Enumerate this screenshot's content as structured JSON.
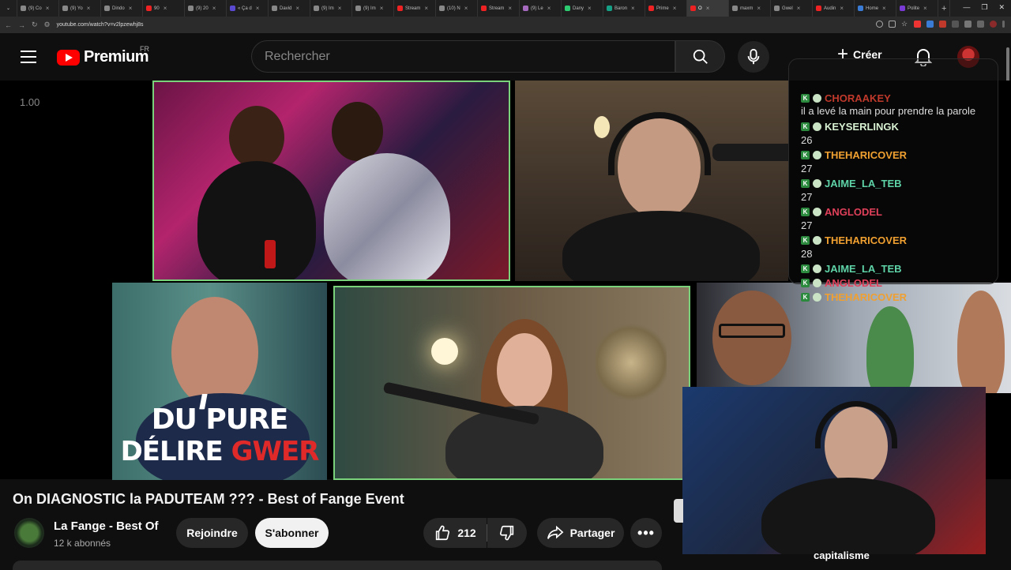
{
  "browser": {
    "tabs": [
      {
        "label": "(9) Co",
        "color": "#888"
      },
      {
        "label": "(9) Yo",
        "color": "#888"
      },
      {
        "label": "Dindo",
        "color": "#888"
      },
      {
        "label": "90",
        "color": "#e22"
      },
      {
        "label": "(9) 20",
        "color": "#888"
      },
      {
        "label": "« Ça d",
        "color": "#5a4ad1"
      },
      {
        "label": "David",
        "color": "#888"
      },
      {
        "label": "(9) Im",
        "color": "#888"
      },
      {
        "label": "(9) Im",
        "color": "#888"
      },
      {
        "label": "Stream",
        "color": "#e22"
      },
      {
        "label": "(10) N",
        "color": "#888"
      },
      {
        "label": "Stream",
        "color": "#e22"
      },
      {
        "label": "(9) Le",
        "color": "#a569bd"
      },
      {
        "label": "Dany",
        "color": "#2ecc71"
      },
      {
        "label": "Baron",
        "color": "#16a085"
      },
      {
        "label": "Prime",
        "color": "#e22"
      },
      {
        "label": "O",
        "color": "#e22",
        "active": true
      },
      {
        "label": "maxm",
        "color": "#888"
      },
      {
        "label": "Gwel",
        "color": "#888"
      },
      {
        "label": "Audin",
        "color": "#e22"
      },
      {
        "label": "Home",
        "color": "#3a7bd5"
      },
      {
        "label": "Polite",
        "color": "#7a3ad5"
      }
    ],
    "url": "youtube.com/watch?v=v2lpzewhj8s"
  },
  "header": {
    "logo_text": "Premium",
    "country": "FR",
    "search_placeholder": "Rechercher",
    "create_label": "Créer"
  },
  "video": {
    "speed": "1.00",
    "overlay_line1": "DU PURE",
    "overlay_line2a": "DÉLIRE ",
    "overlay_line2b": "GWER",
    "overlay_slashes": "////"
  },
  "chat": {
    "first_user": "CHORAAKEY",
    "first_user_color": "#c0392b",
    "first_msg": "il a levé la main pour prendre la parole",
    "entries": [
      {
        "user": "KEYSERLINGK",
        "color": "#d8f0d2",
        "num": "26"
      },
      {
        "user": "THEHARICOVER",
        "color": "#f0a030",
        "num": "27"
      },
      {
        "user": "JAIME_LA_TEB",
        "color": "#5fd3a8",
        "num": "27"
      },
      {
        "user": "ANGLODEL",
        "color": "#e0405a",
        "num": "27"
      },
      {
        "user": "THEHARICOVER",
        "color": "#f0a030",
        "num": "28"
      },
      {
        "user": "JAIME_LA_TEB",
        "color": "#5fd3a8",
        "num": ""
      },
      {
        "user": "ANGLODEL",
        "color": "#e0405a",
        "num": ""
      },
      {
        "user": "THEHARICOVER",
        "color": "#f0a030",
        "num": ""
      }
    ]
  },
  "info": {
    "title": "On DIAGNOSTIC la PADUTEAM ??? - Best of Fange Event",
    "channel_name": "La Fange - Best Of",
    "subscribers": "12 k abonnés",
    "join_label": "Rejoindre",
    "subscribe_label": "S'abonner",
    "likes": "212",
    "share_label": "Partager",
    "bottom_caption": "capitalisme"
  }
}
